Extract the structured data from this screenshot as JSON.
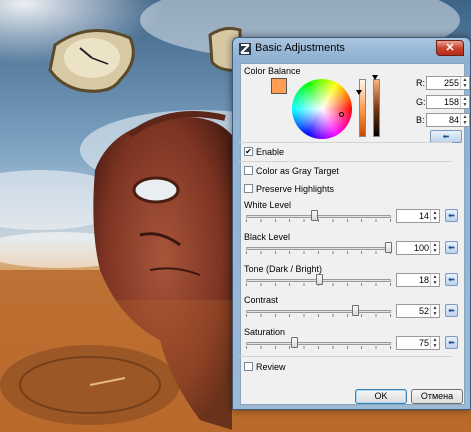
{
  "dialog": {
    "title": "Basic Adjustments",
    "close_symbol": "✕"
  },
  "color_balance": {
    "label": "Color Balance",
    "swatch_color": "#ff9e54",
    "r_label": "R:",
    "r_value": "255",
    "g_label": "G:",
    "g_value": "158",
    "b_label": "B:",
    "b_value": "84",
    "reset_symbol": "⬅"
  },
  "options": {
    "enable": {
      "label": "Enable",
      "checked": true
    },
    "gray_target": {
      "label": "Color as Gray Target",
      "checked": false
    },
    "preserve": {
      "label": "Preserve Highlights",
      "checked": false
    }
  },
  "sliders": [
    {
      "label": "White Level",
      "value": "14",
      "level": 0.47
    },
    {
      "label": "Black Level",
      "value": "100",
      "level": 0.98
    },
    {
      "label": "Tone (Dark / Bright)",
      "value": "18",
      "level": 0.5
    },
    {
      "label": "Contrast",
      "value": "52",
      "level": 0.75
    },
    {
      "label": "Saturation",
      "value": "75",
      "level": 0.33
    }
  ],
  "reset_symbol": "⬅",
  "review": {
    "label": "Review",
    "checked": false
  },
  "buttons": {
    "ok": "OK",
    "cancel": "Отмена"
  },
  "colors": {
    "accent_orange": "#ff9e54",
    "title_gradient": "#9cb9d6"
  }
}
